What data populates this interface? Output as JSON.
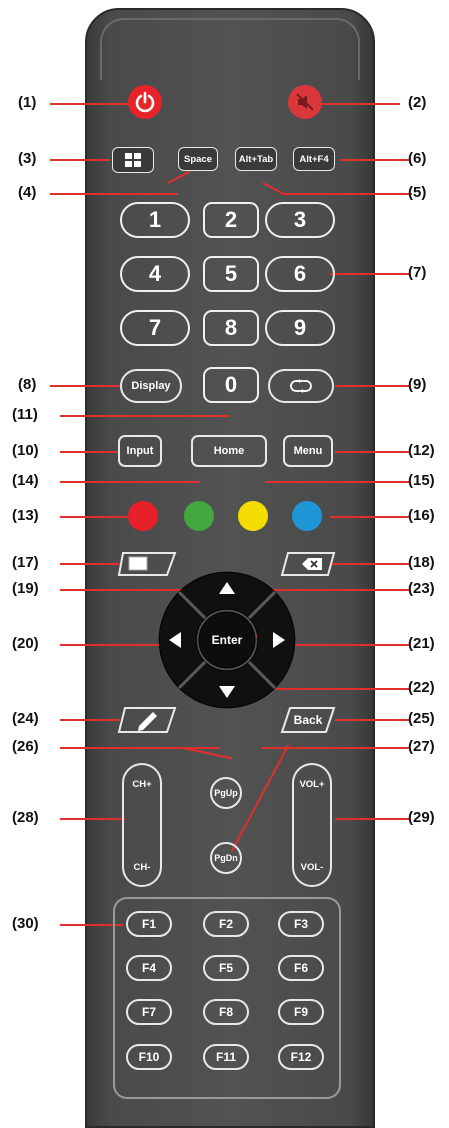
{
  "callouts": [
    {
      "id": "1",
      "text": "(1)"
    },
    {
      "id": "2",
      "text": "(2)"
    },
    {
      "id": "3",
      "text": "(3)"
    },
    {
      "id": "4",
      "text": "(4)"
    },
    {
      "id": "5",
      "text": "(5)"
    },
    {
      "id": "6",
      "text": "(6)"
    },
    {
      "id": "7",
      "text": "(7)"
    },
    {
      "id": "8",
      "text": "(8)"
    },
    {
      "id": "9",
      "text": "(9)"
    },
    {
      "id": "10",
      "text": "(10)"
    },
    {
      "id": "11",
      "text": "(11)"
    },
    {
      "id": "12",
      "text": "(12)"
    },
    {
      "id": "13",
      "text": "(13)"
    },
    {
      "id": "14",
      "text": "(14)"
    },
    {
      "id": "15",
      "text": "(15)"
    },
    {
      "id": "16",
      "text": "(16)"
    },
    {
      "id": "17",
      "text": "(17)"
    },
    {
      "id": "18",
      "text": "(18)"
    },
    {
      "id": "19",
      "text": "(19)"
    },
    {
      "id": "20",
      "text": "(20)"
    },
    {
      "id": "21",
      "text": "(21)"
    },
    {
      "id": "22",
      "text": "(22)"
    },
    {
      "id": "23",
      "text": "(23)"
    },
    {
      "id": "24",
      "text": "(24)"
    },
    {
      "id": "25",
      "text": "(25)"
    },
    {
      "id": "26",
      "text": "(26)"
    },
    {
      "id": "27",
      "text": "(27)"
    },
    {
      "id": "28",
      "text": "(28)"
    },
    {
      "id": "29",
      "text": "(29)"
    },
    {
      "id": "30",
      "text": "(30)"
    }
  ],
  "keys": {
    "space": "Space",
    "alt_tab": "Alt+Tab",
    "alt_f4": "Alt+F4",
    "digits": [
      "1",
      "2",
      "3",
      "4",
      "5",
      "6",
      "7",
      "8",
      "9",
      "0"
    ],
    "display": "Display",
    "input": "Input",
    "home": "Home",
    "menu": "Menu",
    "enter": "Enter",
    "back": "Back",
    "pgup": "PgUp",
    "pgdn": "PgDn",
    "ch_plus": "CH+",
    "ch_minus": "CH-",
    "vol_plus": "VOL+",
    "vol_minus": "VOL-",
    "function_keys": [
      "F1",
      "F2",
      "F3",
      "F4",
      "F5",
      "F6",
      "F7",
      "F8",
      "F9",
      "F10",
      "F11",
      "F12"
    ]
  },
  "colors": {
    "callout_line": "#e0302c",
    "power": "#e8232a",
    "mute": "#d9373a",
    "red": "#e8202a",
    "green": "#43a83f",
    "yellow": "#f3dc00",
    "blue": "#1e96d6",
    "body": "#4c4c4c"
  },
  "icons": {
    "power": "power-icon",
    "mute": "mute-icon",
    "windows": "windows-icon",
    "repeat": "repeat-icon",
    "screen": "screen-icon",
    "delete": "backspace-icon",
    "pen": "pen-icon",
    "up": "arrow-up-icon",
    "down": "arrow-down-icon",
    "left": "arrow-left-icon",
    "right": "arrow-right-icon"
  }
}
